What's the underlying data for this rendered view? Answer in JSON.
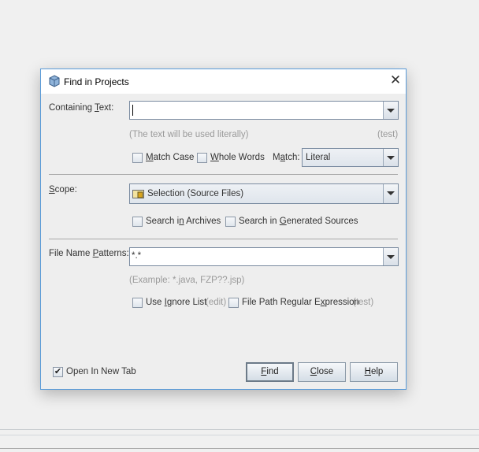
{
  "dialog": {
    "title": "Find in Projects",
    "icon": "cube-icon",
    "containing_text": {
      "label": [
        "Containing ",
        "T",
        "ext:"
      ],
      "value": "",
      "hint": "(The text will be used literally)",
      "test_link": "(test)"
    },
    "match_case": {
      "label": [
        "",
        "M",
        "atch Case"
      ],
      "checked": false
    },
    "whole_words": {
      "label": [
        "",
        "W",
        "hole Words"
      ],
      "checked": false
    },
    "match": {
      "label": [
        "M",
        "a",
        "tch:"
      ],
      "value": "Literal"
    },
    "scope": {
      "label": [
        "",
        "S",
        "cope:"
      ],
      "value": "Selection (Source Files)",
      "icon": "folder-icon"
    },
    "search_archives": {
      "label": [
        "Search i",
        "n",
        " Archives"
      ],
      "checked": false
    },
    "search_generated": {
      "label": [
        "Search in ",
        "G",
        "enerated Sources"
      ],
      "checked": false
    },
    "file_patterns": {
      "label": [
        "File Name ",
        "P",
        "atterns:"
      ],
      "value": "*.*",
      "hint": "(Example: *.java, FZP??.jsp)"
    },
    "use_ignore": {
      "label": [
        "Use ",
        "I",
        "gnore List"
      ],
      "checked": false,
      "edit_link": "(edit)"
    },
    "regex": {
      "label": [
        "File Path Regular E",
        "x",
        "pression"
      ],
      "checked": false,
      "test_link": "(test)"
    },
    "open_new_tab": {
      "label": "Open In New Tab",
      "checked": true
    },
    "buttons": {
      "find": [
        "",
        "F",
        "ind"
      ],
      "close": [
        "",
        "C",
        "lose"
      ],
      "help": [
        "",
        "H",
        "elp"
      ]
    }
  }
}
